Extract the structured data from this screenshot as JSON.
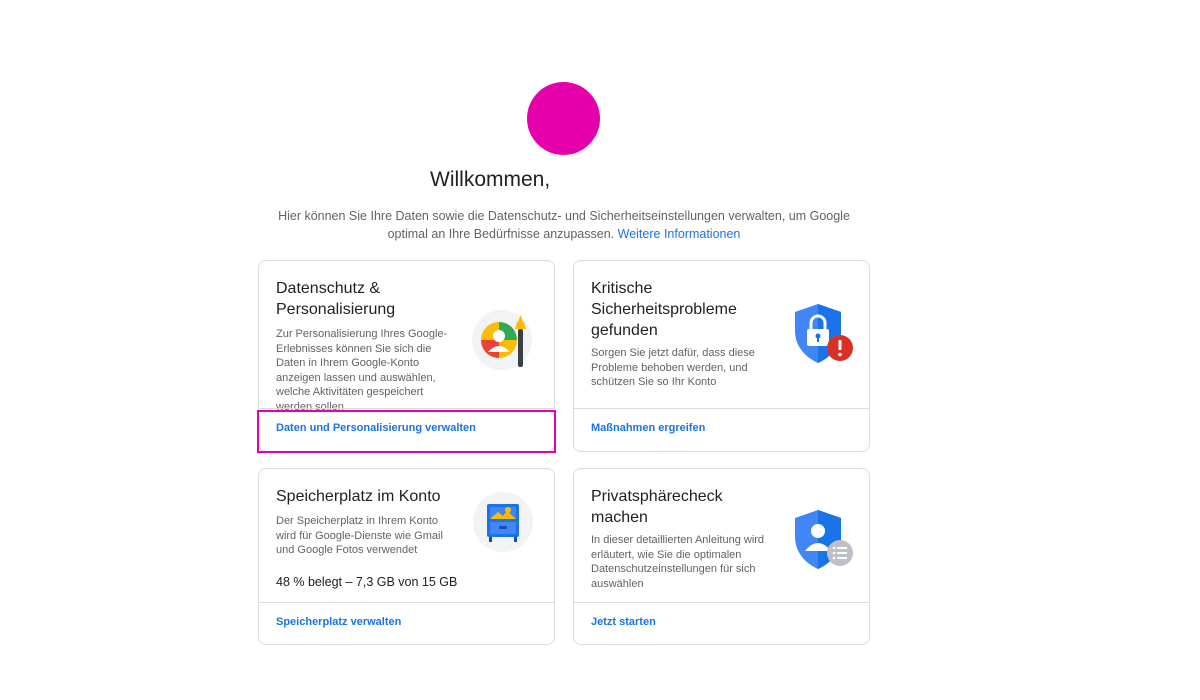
{
  "header": {
    "title": "Willkommen,",
    "intro_text": "Hier können Sie Ihre Daten sowie die Datenschutz- und Sicherheitseinstellungen verwalten, um Google optimal an Ihre Bedürfnisse anzupassen.",
    "intro_link": "Weitere Informationen",
    "avatar_color": "#e600ac"
  },
  "cards": {
    "privacy": {
      "title": "Datenschutz & Personalisierung",
      "description": "Zur Personalisierung Ihres Google-Erlebnisses können Sie sich die Daten in Ihrem Google-Konto anzeigen lassen und auswählen, welche Aktivitäten gespeichert werden sollen",
      "link": "Daten und Personalisierung verwalten",
      "icon": "privacy-personalization-icon"
    },
    "security": {
      "title": "Kritische Sicherheitsprobleme gefunden",
      "description": "Sorgen Sie jetzt dafür, dass diese Probleme behoben werden, und schützen Sie so Ihr Konto",
      "link": "Maßnahmen ergreifen",
      "icon": "security-shield-lock-icon"
    },
    "storage": {
      "title": "Speicherplatz im Konto",
      "description": "Der Speicherplatz in Ihrem Konto wird für Google-Dienste wie Gmail und Google Fotos verwendet",
      "usage": "48 % belegt – 7,3 GB von 15 GB",
      "link": "Speicherplatz verwalten",
      "icon": "storage-cabinet-icon"
    },
    "privacy_check": {
      "title": "Privatsphärecheck machen",
      "description": "In dieser detaillierten Anleitung wird erläutert, wie Sie die optimalen Datenschutzeinstellungen für sich auswählen",
      "link": "Jetzt starten",
      "icon": "privacy-check-shield-icon"
    }
  },
  "colors": {
    "accent_link": "#1a73e8",
    "highlight": "#e600ac",
    "alert_red": "#d93025",
    "shield_blue": "#4285f4"
  }
}
